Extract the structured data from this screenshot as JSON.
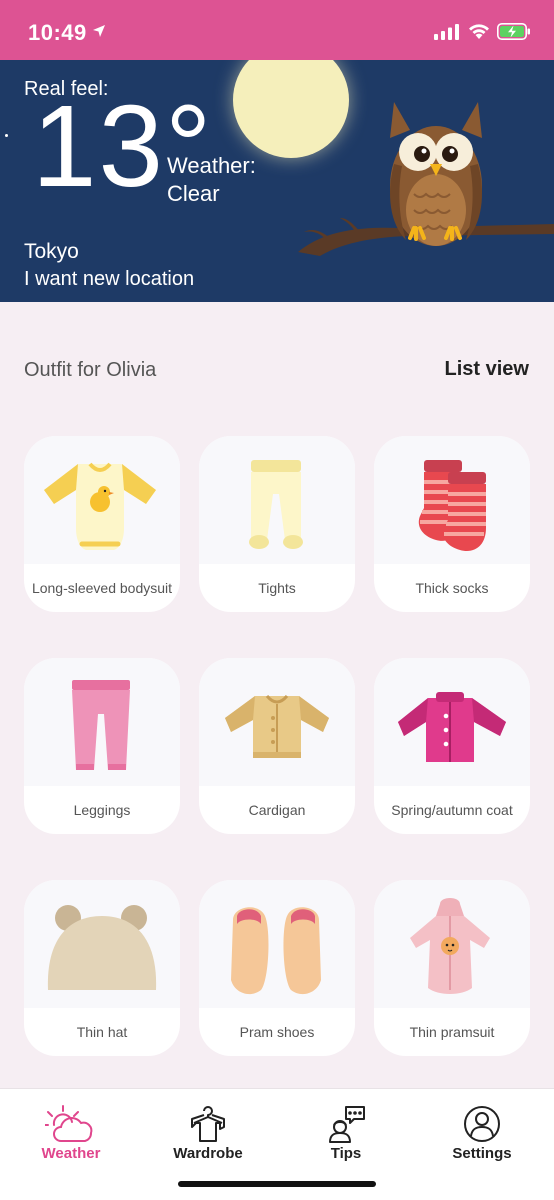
{
  "status_bar": {
    "time": "10:49",
    "background": "#dd5393"
  },
  "weather": {
    "real_feel_label": "Real feel:",
    "temperature": "13°",
    "condition_label": "Weather:",
    "condition_value": "Clear",
    "city": "Tokyo",
    "change_location": "I want new location",
    "background": "#1e3a66"
  },
  "outfit": {
    "title": "Outfit for Olivia",
    "list_view_label": "List view",
    "items": [
      {
        "label": "Long-sleeved bodysuit",
        "icon": "bodysuit-icon"
      },
      {
        "label": "Tights",
        "icon": "tights-icon"
      },
      {
        "label": "Thick socks",
        "icon": "socks-icon"
      },
      {
        "label": "Leggings",
        "icon": "leggings-icon"
      },
      {
        "label": "Cardigan",
        "icon": "cardigan-icon"
      },
      {
        "label": "Spring/autumn coat",
        "icon": "coat-icon"
      },
      {
        "label": "Thin hat",
        "icon": "hat-icon"
      },
      {
        "label": "Pram shoes",
        "icon": "shoes-icon"
      },
      {
        "label": "Thin pramsuit",
        "icon": "pramsuit-icon"
      }
    ]
  },
  "tab_bar": {
    "accent": "#e0468d",
    "tabs": [
      {
        "label": "Weather",
        "icon": "weather-icon",
        "active": true
      },
      {
        "label": "Wardrobe",
        "icon": "wardrobe-icon",
        "active": false
      },
      {
        "label": "Tips",
        "icon": "tips-icon",
        "active": false
      },
      {
        "label": "Settings",
        "icon": "settings-icon",
        "active": false
      }
    ]
  }
}
